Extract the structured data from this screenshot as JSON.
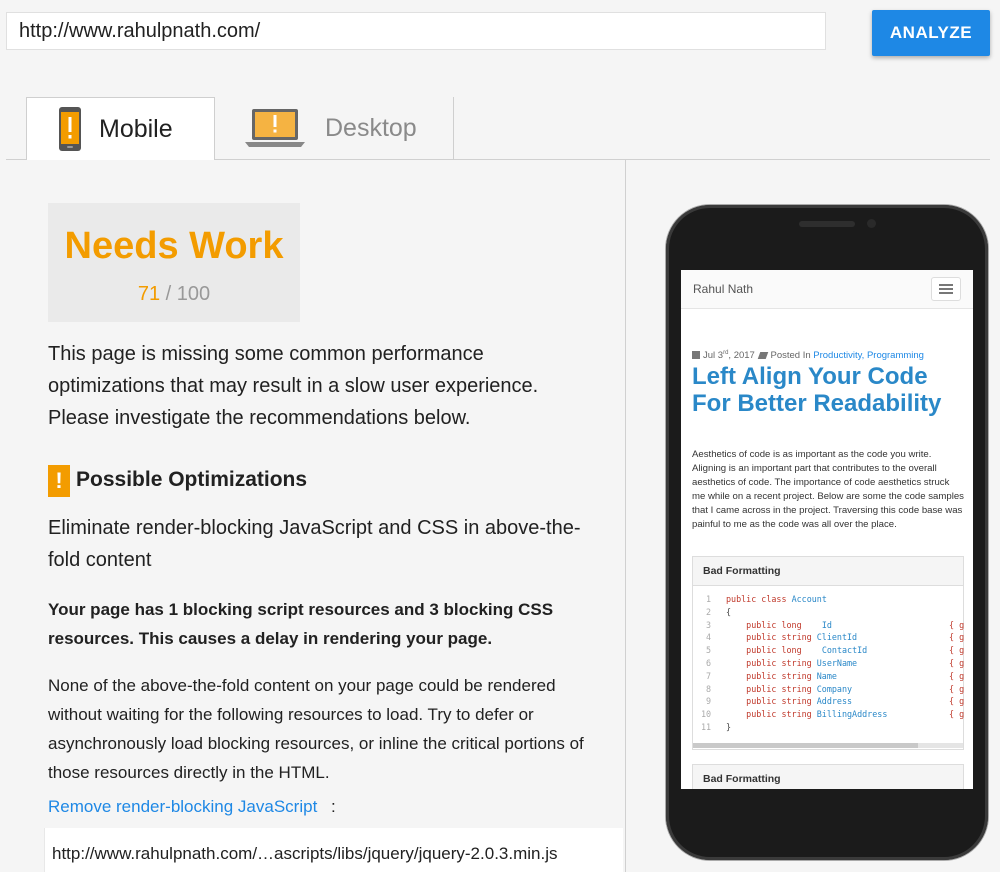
{
  "url_bar": {
    "value": "http://www.rahulpnath.com/"
  },
  "analyze_label": "ANALYZE",
  "tabs": [
    {
      "label": "Mobile",
      "active": true
    },
    {
      "label": "Desktop",
      "active": false
    }
  ],
  "score": {
    "title": "Needs Work",
    "value": "71",
    "max": "/ 100"
  },
  "summary": "This page is missing some common performance optimizations that may result in a slow user experience. Please investigate the recommendations below.",
  "optimizations": {
    "icon": "!",
    "heading": "Possible Optimizations",
    "rule_title": "Eliminate render-blocking JavaScript and CSS in above-the-fold content",
    "rule_bold": "Your page has 1 blocking script resources and 3 blocking CSS resources. This causes a delay in rendering your page.",
    "rule_desc": "None of the above-the-fold content on your page could be rendered without waiting for the following resources to load. Try to defer or asynchronously load blocking resources, or inline the critical portions of those resources directly in the HTML.",
    "link_label": "Remove render-blocking JavaScript",
    "link_suffix": ":",
    "resource": "http://www.rahulpnath.com/…ascripts/libs/jquery/jquery-2.0.3.min.js"
  },
  "preview": {
    "site_name": "Rahul Nath",
    "meta_date": "Jul 3",
    "meta_date_sup": "rd",
    "meta_year": ", 2017",
    "meta_posted": "Posted In",
    "meta_categories": "Productivity, Programming",
    "post_title": "Left Align Your Code For Better Readability",
    "post_body": "Aesthetics of code is as important as the code you write. Aligning is an important part that contributes to the overall aesthetics of code. The importance of code aesthetics struck me while on a recent project. Below are some the code samples that I came across in the project. Traversing this code base was painful to me as the code was all over the place.",
    "code_card_title": "Bad Formatting",
    "code_lines": [
      {
        "n": "1",
        "kw": "public class",
        "ty": "",
        "name": "Account",
        "brace": ""
      },
      {
        "n": "2",
        "kw": "",
        "ty": "",
        "name": "{",
        "brace": ""
      },
      {
        "n": "3",
        "kw": "    public",
        "ty": "long",
        "name": "   Id",
        "brace": "{ g"
      },
      {
        "n": "4",
        "kw": "    public",
        "ty": "string",
        "name": "ClientId",
        "brace": "{ g"
      },
      {
        "n": "5",
        "kw": "    public",
        "ty": "long",
        "name": "   ContactId",
        "brace": "{ g"
      },
      {
        "n": "6",
        "kw": "    public",
        "ty": "string",
        "name": "UserName",
        "brace": "{ g"
      },
      {
        "n": "7",
        "kw": "    public",
        "ty": "string",
        "name": "Name",
        "brace": "{ g"
      },
      {
        "n": "8",
        "kw": "    public",
        "ty": "string",
        "name": "Company",
        "brace": "{ g"
      },
      {
        "n": "9",
        "kw": "    public",
        "ty": "string",
        "name": "Address",
        "brace": "{ g"
      },
      {
        "n": "10",
        "kw": "    public",
        "ty": "string",
        "name": "BillingAddress",
        "brace": "{ g"
      },
      {
        "n": "11",
        "kw": "",
        "ty": "",
        "name": "}",
        "brace": ""
      }
    ],
    "code_card2_title": "Bad Formatting"
  },
  "colors": {
    "accent": "#1e88e5",
    "warning": "#f39c00",
    "post_title": "#2a88c8"
  },
  "icons": {
    "mobile_tab": "phone-warning-icon",
    "desktop_tab": "laptop-warning-icon",
    "optimization": "warning-icon",
    "preview_menu": "hamburger-menu-icon",
    "meta_calendar": "calendar-icon",
    "meta_tag": "tag-icon"
  }
}
